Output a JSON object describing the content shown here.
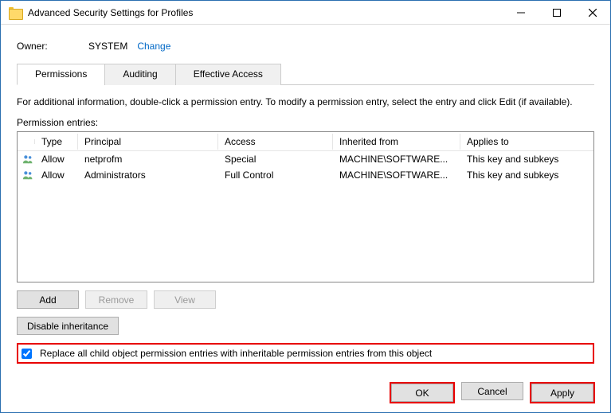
{
  "window": {
    "title": "Advanced Security Settings for Profiles"
  },
  "owner": {
    "label": "Owner:",
    "value": "SYSTEM",
    "change": "Change"
  },
  "tabs": {
    "permissions": "Permissions",
    "auditing": "Auditing",
    "effective": "Effective Access"
  },
  "info": "For additional information, double-click a permission entry. To modify a permission entry, select the entry and click Edit (if available).",
  "entriesLabel": "Permission entries:",
  "columns": {
    "type": "Type",
    "principal": "Principal",
    "access": "Access",
    "inherit": "Inherited from",
    "applies": "Applies to"
  },
  "rows": [
    {
      "type": "Allow",
      "principal": "netprofm",
      "access": "Special",
      "inherit": "MACHINE\\SOFTWARE...",
      "applies": "This key and subkeys"
    },
    {
      "type": "Allow",
      "principal": "Administrators",
      "access": "Full Control",
      "inherit": "MACHINE\\SOFTWARE...",
      "applies": "This key and subkeys"
    }
  ],
  "buttons": {
    "add": "Add",
    "remove": "Remove",
    "view": "View",
    "disable": "Disable inheritance",
    "ok": "OK",
    "cancel": "Cancel",
    "apply": "Apply"
  },
  "checkbox": {
    "label": "Replace all child object permission entries with inheritable permission entries from this object",
    "checked": true
  }
}
